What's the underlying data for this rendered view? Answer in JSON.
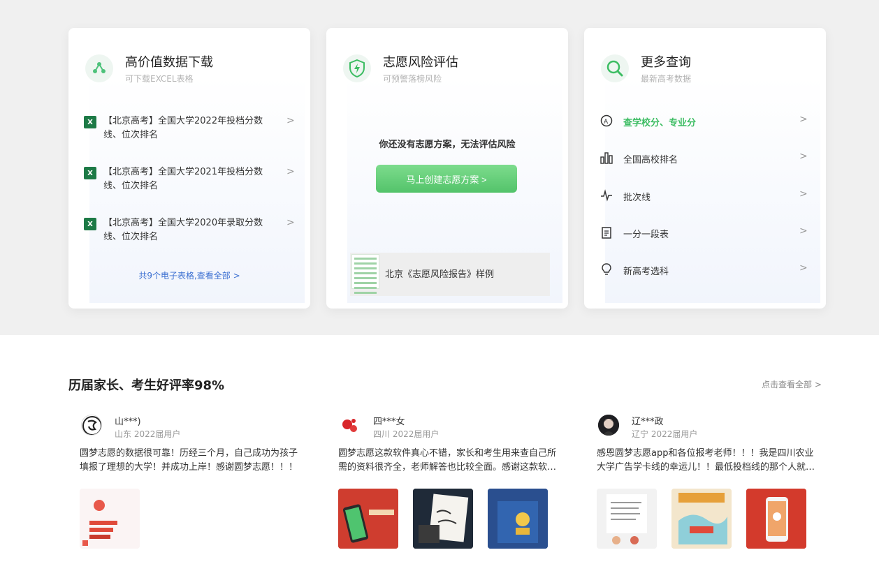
{
  "cards": {
    "download": {
      "title": "高价值数据下载",
      "subtitle": "可下载EXCEL表格",
      "items": [
        {
          "line1": "【北京高考】全国大学2022年投档分数",
          "line2": "线、位次排名"
        },
        {
          "line1": "【北京高考】全国大学2021年投档分数",
          "line2": "线、位次排名"
        },
        {
          "line1": "【北京高考】全国大学2020年录取分数",
          "line2": "线、位次排名"
        }
      ],
      "more_link": "共9个电子表格,查看全部 >"
    },
    "risk": {
      "title": "志愿风险评估",
      "subtitle": "可预警落榜风险",
      "message": "你还没有志愿方案，无法评估风险",
      "button_label": "马上创建志愿方案 >",
      "sample_label": "北京《志愿风险报告》样例"
    },
    "query": {
      "title": "更多查询",
      "subtitle": "最新高考数据",
      "items": [
        {
          "label": "查学校分、专业分",
          "icon": "school-score-icon"
        },
        {
          "label": "全国高校排名",
          "icon": "ranking-icon"
        },
        {
          "label": "批次线",
          "icon": "line-chart-icon"
        },
        {
          "label": "一分一段表",
          "icon": "clipboard-icon"
        },
        {
          "label": "新高考选科",
          "icon": "lightbulb-icon"
        }
      ]
    }
  },
  "chevron": ">",
  "reviews_section": {
    "title": "历届家长、考生好评率98%",
    "view_all": "点击查看全部 >",
    "reviews": [
      {
        "name": "山***)",
        "meta": "山东 2022届用户",
        "text": "圆梦志愿的数据很可靠！历经三个月，自己成功为孩子填报了理想的大学！并成功上岸！感谢圆梦志愿！！！"
      },
      {
        "name": "四***女",
        "meta": "四川 2022届用户",
        "text": "圆梦志愿这款软件真心不错，家长和考生用来查自己所需的资料很齐全，老师解答也比较全面。感谢这款软件的帮助"
      },
      {
        "name": "辽***政",
        "meta": "辽宁 2022届用户",
        "text": "感恩圆梦志愿app和各位报考老师！！！我是四川农业大学广告学卡线的幸运儿！！最低投档线的那个人就是我"
      }
    ]
  }
}
